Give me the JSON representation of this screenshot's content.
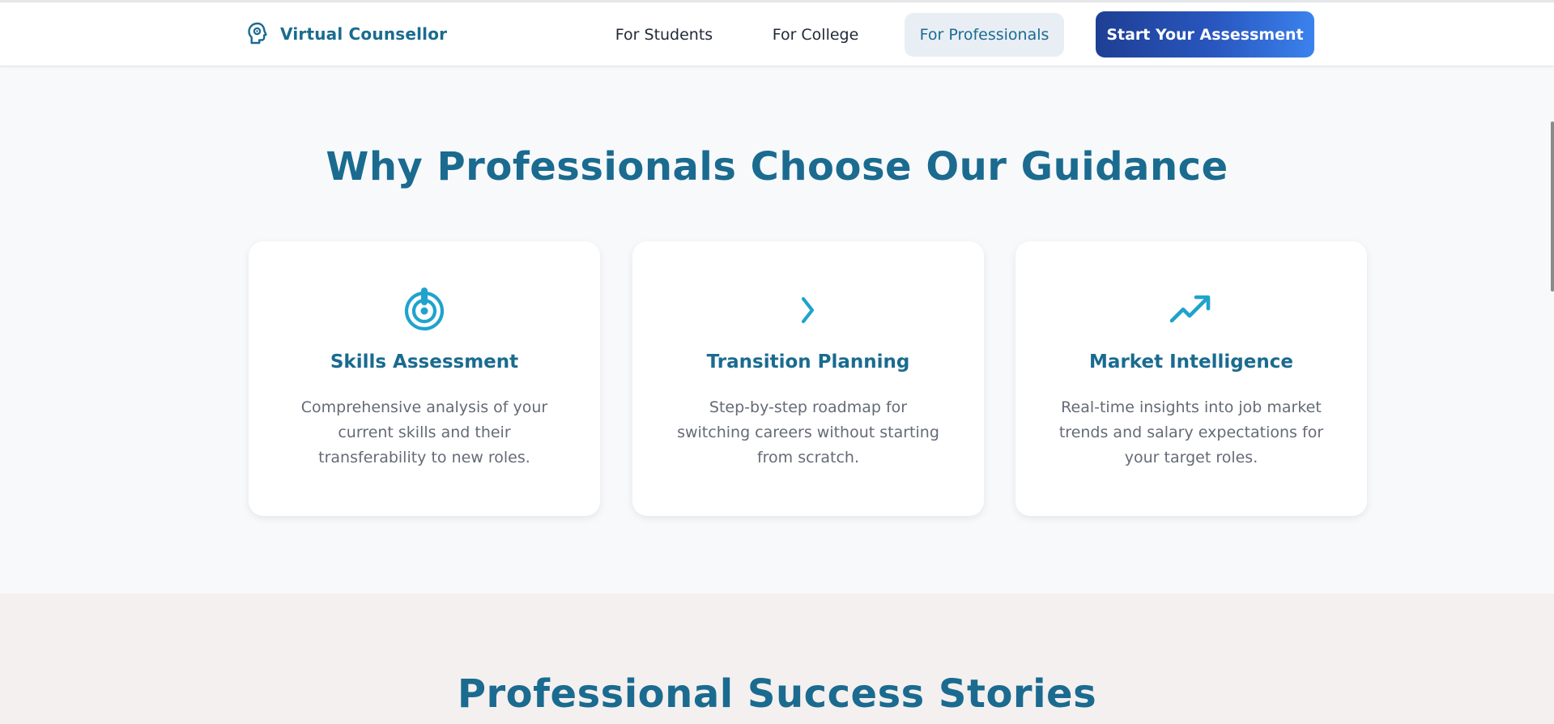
{
  "brand": {
    "name": "Virtual Counsellor",
    "icon": "brain-head-icon"
  },
  "nav": {
    "items": [
      "For Students",
      "For College",
      "For Professionals"
    ],
    "active": "For Professionals",
    "cta_label": "Start Your Assessment"
  },
  "why": {
    "title": "Why Professionals Choose Our Guidance",
    "cards": [
      {
        "icon": "target-icon",
        "title": "Skills Assessment",
        "text": "Comprehensive analysis of your current skills and their transferability to new roles."
      },
      {
        "icon": "chevron-right-icon",
        "title": "Transition Planning",
        "text": "Step-by-step roadmap for switching careers without starting from scratch."
      },
      {
        "icon": "trending-up-icon",
        "title": "Market Intelligence",
        "text": "Real-time insights into job market trends and salary expectations for your target roles."
      }
    ]
  },
  "stories": {
    "title": "Professional Success Stories"
  },
  "colors": {
    "accent": "#1a6b8f",
    "icon": "#1fa3cc",
    "cta_start": "#1e3f93",
    "cta_end": "#3b82ee"
  }
}
